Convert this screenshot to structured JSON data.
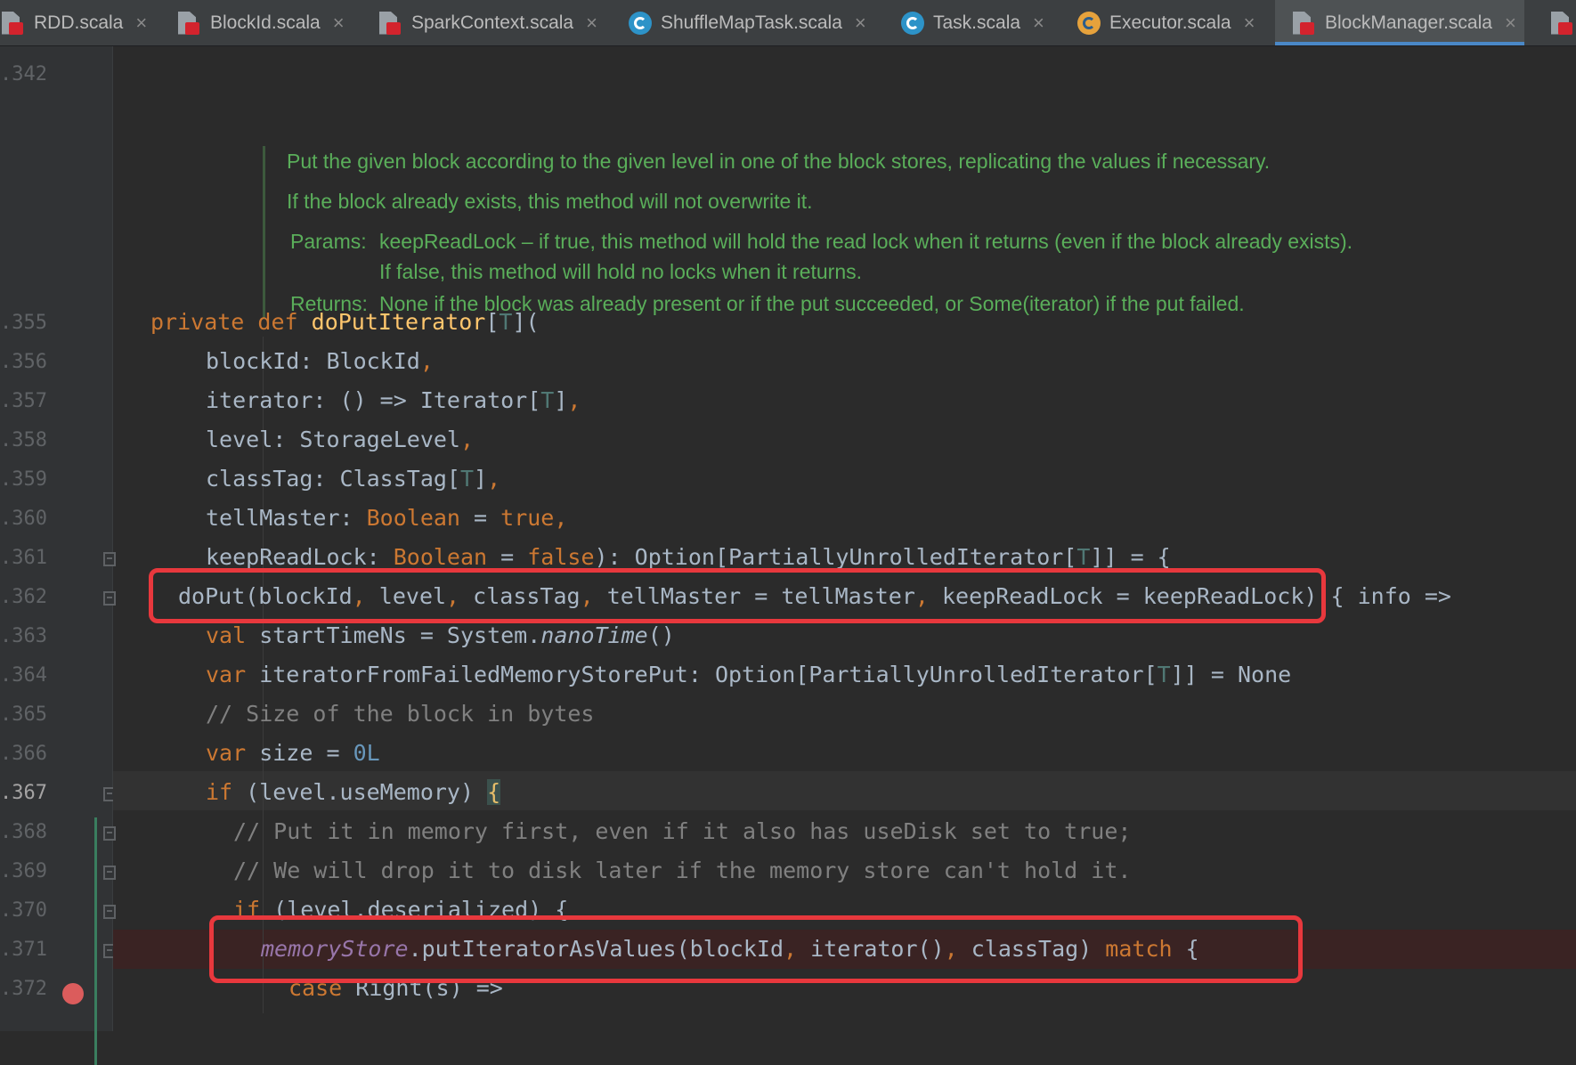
{
  "tabs": [
    {
      "label": "RDD.scala",
      "icon": "scala-file-icon",
      "active": false
    },
    {
      "label": "BlockId.scala",
      "icon": "scala-file-icon",
      "active": false
    },
    {
      "label": "SparkContext.scala",
      "icon": "scala-file-icon",
      "active": false
    },
    {
      "label": "ShuffleMapTask.scala",
      "icon": "scala-class-icon",
      "active": false
    },
    {
      "label": "Task.scala",
      "icon": "scala-abstract-class-icon",
      "active": false
    },
    {
      "label": "Executor.scala",
      "icon": "scala-object-icon",
      "active": false
    },
    {
      "label": "BlockManager.scala",
      "icon": "scala-file-icon",
      "active": true
    }
  ],
  "close_glyph": "×",
  "line_numbers": [
    ".342",
    ".355",
    ".356",
    ".357",
    ".358",
    ".359",
    ".360",
    ".361",
    ".362",
    ".363",
    ".364",
    ".365",
    ".366",
    ".367",
    ".368",
    ".369",
    ".370",
    ".371",
    ".372"
  ],
  "doc": {
    "line1": "Put the given block according to the given level in one of the block stores, replicating the values if necessary.",
    "line2": "If the block already exists, this method will not overwrite it.",
    "params_label": "Params:",
    "params_text": "keepReadLock – if true, this method will hold the read lock when it returns (even if the block already exists). If false, this method will hold no locks when it returns.",
    "returns_label": "Returns:",
    "returns_text": "None if the block was already present or if the put succeeded, or Some(iterator) if the put failed."
  },
  "code": {
    "kw_private": "private",
    "kw_def": "def",
    "fn_name": "doPutIterator",
    "type_T": "T",
    "param_blockId": "blockId: BlockId",
    "param_iterator_a": "iterator: () => Iterator[",
    "param_level": "level: StorageLevel",
    "param_classTag_a": "classTag: ClassTag[",
    "param_tellMaster_a": "tellMaster: ",
    "kw_Boolean": "Boolean",
    "kw_true": "true",
    "kw_false": "false",
    "param_keepReadLock_a": "keepReadLock: ",
    "ret_type_a": "): Option[PartiallyUnrolledIterator[",
    "ret_type_b": "]] = {",
    "doput_call": "doPut(blockId",
    "doput_level": " level",
    "doput_classTag": " classTag",
    "doput_tellMaster": " tellMaster = tellMaster",
    "doput_keepReadLock": " keepReadLock = keepReadLock)",
    "doput_tail": " { info =>",
    "kw_val": "val",
    "startTime_a": " startTimeNs = System.",
    "startTime_fn": "nanoTime",
    "startTime_b": "()",
    "kw_var": "var",
    "failed_a": " iteratorFromFailedMemoryStorePut: Option[PartiallyUnrolledIterator[",
    "failed_b": "]] = None",
    "comment_size": "// Size of the block in bytes",
    "size_a": " size = ",
    "size_val": "0L",
    "kw_if": "if",
    "if_mem": " (level.useMemory) ",
    "open_brace": "{",
    "comment_put1": "// Put it in memory first, even if it also has useDisk set to true;",
    "comment_put2": "// We will drop it to disk later if the memory store can't hold it.",
    "if_deser": " (level.deserialized) {",
    "memoryStore": "memoryStore",
    "put_call": ".putIteratorAsValues(blockId",
    "put_iter": " iterator()",
    "put_ct": " classTag) ",
    "kw_match": "match",
    "match_brace": " {",
    "kw_case": "case",
    "case_right": " Right(s) =>"
  }
}
